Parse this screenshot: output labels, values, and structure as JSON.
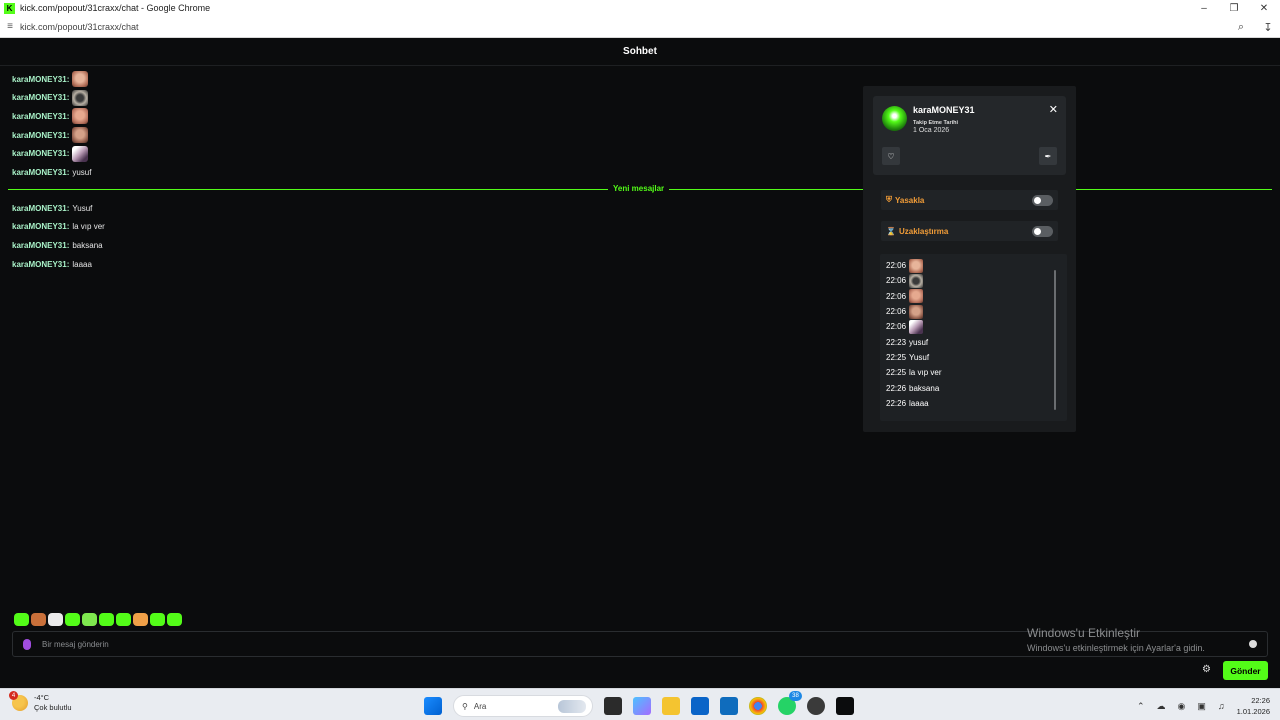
{
  "browser": {
    "title": "kick.com/popout/31craxx/chat - Google Chrome",
    "url": "kick.com/popout/31craxx/chat"
  },
  "header": {
    "title": "Sohbet"
  },
  "chat": {
    "before_new": [
      {
        "user": "karaMONEY31:",
        "text": "",
        "emote": "e1"
      },
      {
        "user": "karaMONEY31:",
        "text": "",
        "emote": "e2"
      },
      {
        "user": "karaMONEY31:",
        "text": "",
        "emote": "e3"
      },
      {
        "user": "karaMONEY31:",
        "text": "",
        "emote": "e4"
      },
      {
        "user": "karaMONEY31:",
        "text": "",
        "emote": "e5"
      },
      {
        "user": "karaMONEY31:",
        "text": "yusuf",
        "emote": ""
      }
    ],
    "new_messages_label": "Yeni mesajlar",
    "after_new": [
      {
        "user": "karaMONEY31:",
        "text": "Yusuf"
      },
      {
        "user": "karaMONEY31:",
        "text": "la vıp ver"
      },
      {
        "user": "karaMONEY31:",
        "text": "baksana"
      },
      {
        "user": "karaMONEY31:",
        "text": "laaaa"
      }
    ]
  },
  "user_card": {
    "username": "karaMONEY31",
    "follow_label": "Takip Etme Tarihi",
    "follow_date": "1 Oca 2026",
    "close_icon": "close-icon",
    "ban_label": "Yasakla",
    "timeout_label": "Uzaklaştırma",
    "history": [
      {
        "time": "22:06",
        "text": "",
        "emote": "e1"
      },
      {
        "time": "22:06",
        "text": "",
        "emote": "e2"
      },
      {
        "time": "22:06",
        "text": "",
        "emote": "e3"
      },
      {
        "time": "22:06",
        "text": "",
        "emote": "e4"
      },
      {
        "time": "22:06",
        "text": "",
        "emote": "e5"
      },
      {
        "time": "22:23",
        "text": "yusuf",
        "emote": ""
      },
      {
        "time": "22:25",
        "text": "Yusuf",
        "emote": ""
      },
      {
        "time": "22:25",
        "text": "la vıp ver",
        "emote": ""
      },
      {
        "time": "22:26",
        "text": "baksana",
        "emote": ""
      },
      {
        "time": "22:26",
        "text": "laaaa",
        "emote": ""
      }
    ]
  },
  "composer": {
    "placeholder": "Bir mesaj gönderin",
    "send_label": "Gönder"
  },
  "watermark": {
    "line1": "Windows'u Etkinleştir",
    "line2": "Windows'u etkinleştirmek için Ayarlar'a gidin."
  },
  "taskbar": {
    "temperature": "-4°C",
    "weather": "Çok bulutlu",
    "weather_badge": "4",
    "search_label": "Ara",
    "whatsapp_badge": "38",
    "time": "22:26",
    "date": "1.01.2026"
  },
  "colors": {
    "accent": "#53fc18",
    "username": "#a9f2c8",
    "mod_action": "#f29d38"
  }
}
